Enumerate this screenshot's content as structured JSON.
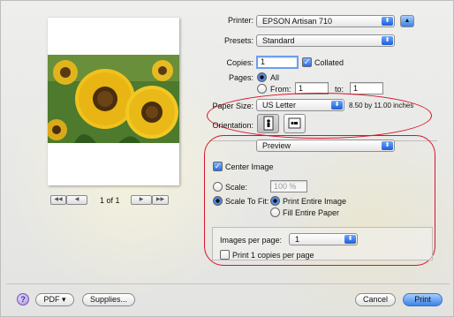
{
  "printer": {
    "label": "Printer:",
    "value": "EPSON Artisan 710"
  },
  "presets": {
    "label": "Presets:",
    "value": "Standard"
  },
  "copies": {
    "label": "Copies:",
    "value": "1",
    "collated_label": "Collated"
  },
  "pages": {
    "label": "Pages:",
    "all_label": "All",
    "from_label": "From:",
    "from_value": "1",
    "to_label": "to:",
    "to_value": "1"
  },
  "paper_size": {
    "label": "Paper Size:",
    "value": "US Letter",
    "dimensions": "8.50 by 11.00 inches"
  },
  "orientation": {
    "label": "Orientation:"
  },
  "section": {
    "value": "Preview"
  },
  "center_image": {
    "label": "Center Image"
  },
  "scale": {
    "label": "Scale:",
    "value": "100 %"
  },
  "scale_to_fit": {
    "label": "Scale To Fit:",
    "print_entire": "Print Entire Image",
    "fill_entire": "Fill Entire Paper"
  },
  "images_per_page": {
    "label": "Images per page:",
    "value": "1"
  },
  "print_copies": {
    "label": "Print 1 copies per page"
  },
  "pager": {
    "text": "1 of 1",
    "first": "◀◀",
    "prev": "◀",
    "next": "▶",
    "last": "▶▶"
  },
  "buttons": {
    "help": "?",
    "pdf": "PDF ▾",
    "supplies": "Supplies...",
    "cancel": "Cancel",
    "print": "Print"
  },
  "annotation_color": "#d6142b"
}
